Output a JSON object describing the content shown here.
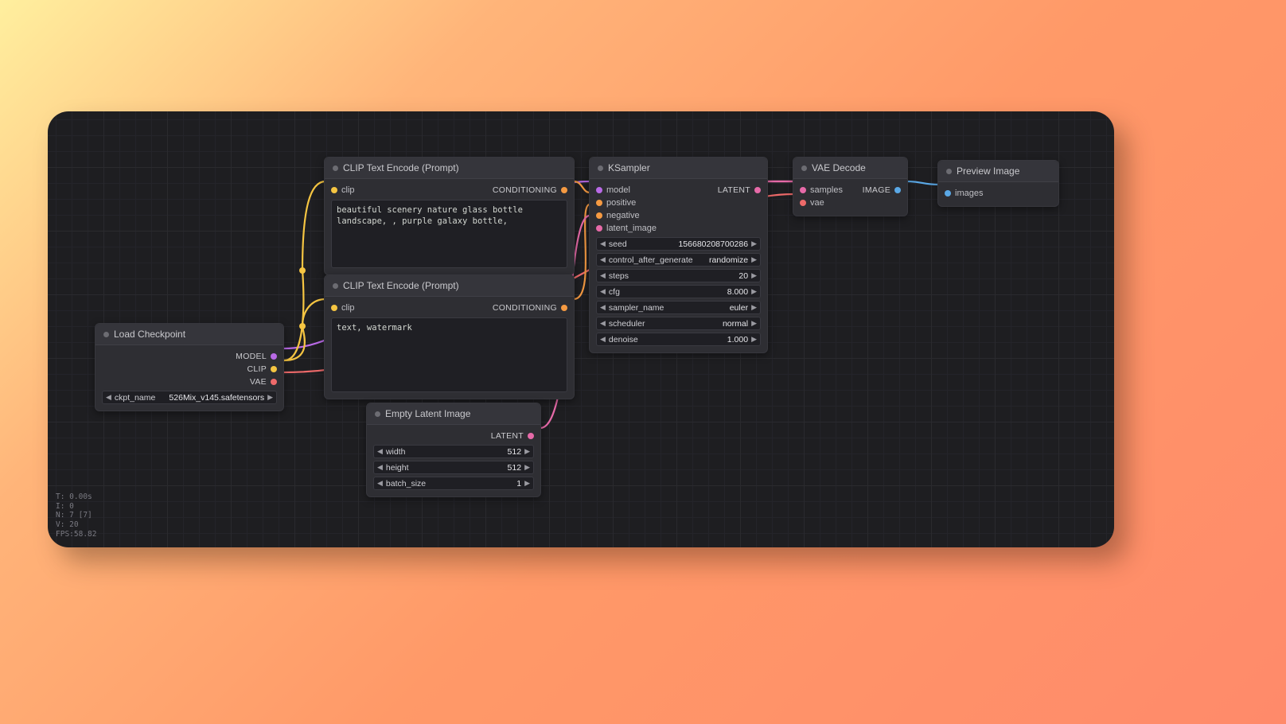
{
  "stats": {
    "t": "T: 0.00s",
    "i": "I: 0",
    "n": "N: 7 [7]",
    "v": "V: 20",
    "fps": "FPS:58.82"
  },
  "nodes": {
    "load": {
      "title": "Load Checkpoint",
      "outputs": {
        "model": "MODEL",
        "clip": "CLIP",
        "vae": "VAE"
      },
      "widget": {
        "name": "ckpt_name",
        "value": "526Mix_v145.safetensors"
      }
    },
    "clip1": {
      "title": "CLIP Text Encode (Prompt)",
      "input": "clip",
      "output": "CONDITIONING",
      "text": "beautiful scenery nature glass bottle landscape, , purple galaxy bottle,"
    },
    "clip2": {
      "title": "CLIP Text Encode (Prompt)",
      "input": "clip",
      "output": "CONDITIONING",
      "text": "text, watermark"
    },
    "empty": {
      "title": "Empty Latent Image",
      "output": "LATENT",
      "widgets": [
        {
          "name": "width",
          "value": "512"
        },
        {
          "name": "height",
          "value": "512"
        },
        {
          "name": "batch_size",
          "value": "1"
        }
      ]
    },
    "ks": {
      "title": "KSampler",
      "inputs": {
        "model": "model",
        "positive": "positive",
        "negative": "negative",
        "latent": "latent_image"
      },
      "output": "LATENT",
      "widgets": [
        {
          "name": "seed",
          "value": "156680208700286"
        },
        {
          "name": "control_after_generate",
          "value": "randomize"
        },
        {
          "name": "steps",
          "value": "20"
        },
        {
          "name": "cfg",
          "value": "8.000"
        },
        {
          "name": "sampler_name",
          "value": "euler"
        },
        {
          "name": "scheduler",
          "value": "normal"
        },
        {
          "name": "denoise",
          "value": "1.000"
        }
      ]
    },
    "vae": {
      "title": "VAE Decode",
      "inputs": {
        "samples": "samples",
        "vae": "vae"
      },
      "output": "IMAGE"
    },
    "prev": {
      "title": "Preview Image",
      "input": "images"
    }
  }
}
